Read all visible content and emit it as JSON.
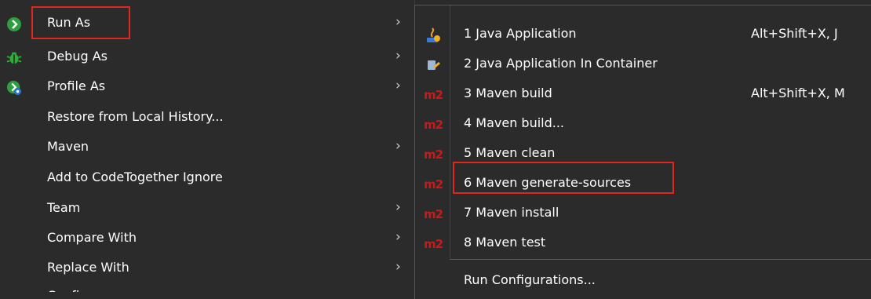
{
  "main_menu": {
    "items": [
      {
        "label": "Run As",
        "icon": "run-icon",
        "submenu": true
      },
      {
        "label": "Debug As",
        "icon": "bug-icon",
        "submenu": true
      },
      {
        "label": "Profile As",
        "icon": "profile-icon",
        "submenu": true
      },
      {
        "label": "Restore from Local History...",
        "icon": "",
        "submenu": false
      },
      {
        "label": "Maven",
        "icon": "",
        "submenu": true
      },
      {
        "label": "Add to CodeTogether Ignore",
        "icon": "",
        "submenu": false
      },
      {
        "label": "Team",
        "icon": "",
        "submenu": true
      },
      {
        "label": "Compare With",
        "icon": "",
        "submenu": true
      },
      {
        "label": "Replace With",
        "icon": "",
        "submenu": true
      },
      {
        "label": "Configure",
        "icon": "",
        "submenu": true
      }
    ],
    "arrow": "›"
  },
  "submenu": {
    "items": [
      {
        "label": "1 Java Application",
        "accelerator": "Alt+Shift+X, J",
        "icon": "java-app-icon"
      },
      {
        "label": "2 Java Application In Container",
        "accelerator": "",
        "icon": "java-container-icon"
      },
      {
        "label": "3 Maven build",
        "accelerator": "Alt+Shift+X, M",
        "icon": "m2"
      },
      {
        "label": "4 Maven build...",
        "accelerator": "",
        "icon": "m2"
      },
      {
        "label": "5 Maven clean",
        "accelerator": "",
        "icon": "m2"
      },
      {
        "label": "6 Maven generate-sources",
        "accelerator": "",
        "icon": "m2"
      },
      {
        "label": "7 Maven install",
        "accelerator": "",
        "icon": "m2"
      },
      {
        "label": "8 Maven test",
        "accelerator": "",
        "icon": "m2"
      }
    ],
    "run_configurations": "Run Configurations...",
    "m2_text": "m2"
  },
  "colors": {
    "background": "#2b2b2b",
    "highlight_border": "#e1261c",
    "m2_red": "#c71a1a"
  }
}
